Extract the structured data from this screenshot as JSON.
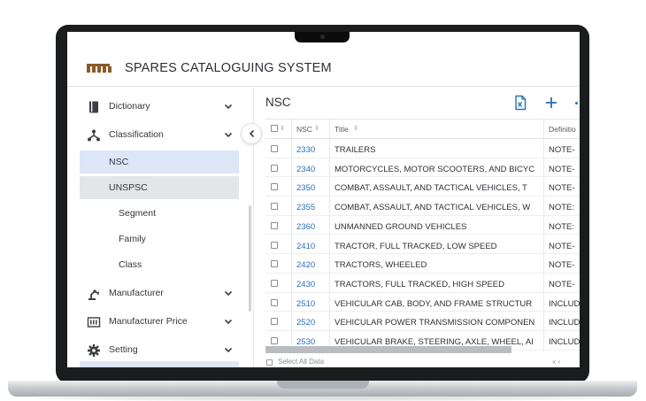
{
  "app": {
    "title": "SPARES CATALOGUING SYSTEM",
    "logo_icon": "brand-logo",
    "brand_color": "#8a5a2b"
  },
  "sidebar": {
    "items": [
      {
        "label": "Dictionary",
        "icon": "book-icon"
      },
      {
        "label": "Classification",
        "icon": "hierarchy-icon"
      },
      {
        "label": "Manufacturer",
        "icon": "robot-arm-icon"
      },
      {
        "label": "Manufacturer Price",
        "icon": "price-table-icon"
      },
      {
        "label": "Setting",
        "icon": "gear-icon"
      }
    ],
    "sub_items": [
      {
        "label": "NSC",
        "state": "selected"
      },
      {
        "label": "UNSPSC",
        "state": "expanded"
      }
    ],
    "leaf_items": [
      {
        "label": "Segment"
      },
      {
        "label": "Family"
      },
      {
        "label": "Class"
      }
    ],
    "selected_color": "#dde7f7"
  },
  "main": {
    "title": "NSC",
    "toolbar": {
      "export_icon": "excel-export-icon",
      "add_icon": "plus-icon"
    },
    "columns": [
      "NSC",
      "Title",
      "Definitio"
    ],
    "rows": [
      {
        "nsc": "2330",
        "title": "TRAILERS",
        "definition": "NOTE-"
      },
      {
        "nsc": "2340",
        "title": "MOTORCYCLES, MOTOR SCOOTERS, AND BICYC",
        "definition": "NOTE-"
      },
      {
        "nsc": "2350",
        "title": "COMBAT, ASSAULT, AND TACTICAL VEHICLES, T",
        "definition": "NOTE-"
      },
      {
        "nsc": "2355",
        "title": "COMBAT, ASSAULT, AND TACTICAL VEHICLES, W",
        "definition": "NOTE:"
      },
      {
        "nsc": "2360",
        "title": "UNMANNED GROUND VEHICLES",
        "definition": "NOTE:"
      },
      {
        "nsc": "2410",
        "title": "TRACTOR, FULL TRACKED, LOW SPEED",
        "definition": "NOTE-"
      },
      {
        "nsc": "2420",
        "title": "TRACTORS, WHEELED",
        "definition": "NOTE-"
      },
      {
        "nsc": "2430",
        "title": "TRACTORS, FULL TRACKED, HIGH SPEED",
        "definition": "NOTE-"
      },
      {
        "nsc": "2510",
        "title": "VEHICULAR CAB, BODY, AND FRAME STRUCTUR",
        "definition": "INCLUD"
      },
      {
        "nsc": "2520",
        "title": "VEHICULAR POWER TRANSMISSION COMPONEN",
        "definition": "INCLUD"
      },
      {
        "nsc": "2530",
        "title": "VEHICULAR BRAKE, STEERING, AXLE, WHEEL, AI",
        "definition": "INCLUD"
      }
    ],
    "footer": {
      "select_all": "Select All Data"
    },
    "link_color": "#2a6fb5"
  }
}
